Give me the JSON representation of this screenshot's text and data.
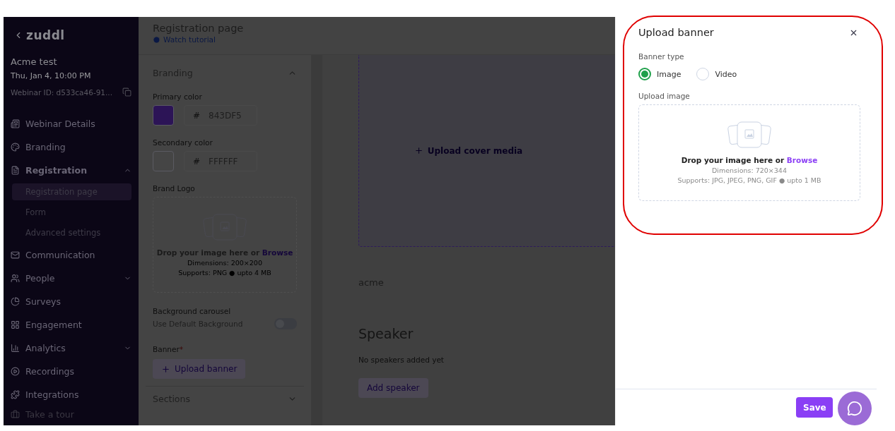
{
  "sidebar": {
    "logo": "zuddl",
    "event": {
      "name": "Acme test",
      "date": "Thu, Jan 4, 10:00 PM",
      "webinar_id": "Webinar ID: d533ca46-91..."
    },
    "nav": [
      {
        "label": "Webinar Details",
        "kind": "link"
      },
      {
        "label": "Branding",
        "kind": "link"
      },
      {
        "label": "Registration",
        "kind": "group",
        "expanded": true,
        "children": [
          {
            "label": "Registration page",
            "selected": true
          },
          {
            "label": "Form",
            "selected": false
          },
          {
            "label": "Advanced settings",
            "selected": false
          }
        ]
      },
      {
        "label": "Communication",
        "kind": "link"
      },
      {
        "label": "People",
        "kind": "group",
        "expanded": false
      },
      {
        "label": "Surveys",
        "kind": "link"
      },
      {
        "label": "Engagement",
        "kind": "link"
      },
      {
        "label": "Analytics",
        "kind": "group",
        "expanded": false
      },
      {
        "label": "Recordings",
        "kind": "link"
      },
      {
        "label": "Integrations",
        "kind": "link"
      }
    ],
    "tour_button": "Take a tour"
  },
  "header": {
    "title": "Registration page",
    "tutorial_link": "Watch tutorial"
  },
  "settings": {
    "sections": [
      {
        "title": "Branding",
        "expanded": true
      },
      {
        "title": "Sections",
        "expanded": false
      }
    ],
    "primary_color": {
      "label": "Primary color",
      "hash": "#",
      "value": "843DF5",
      "color": "#2c1456"
    },
    "secondary_color": {
      "label": "Secondary color",
      "hash": "#",
      "value": "FFFFFF",
      "color": "#454545"
    },
    "brand_logo": {
      "label": "Brand Logo",
      "prompt": "Drop your image here or",
      "link": "Browse",
      "dimensions": "Dimensions: 200×200",
      "supports": "Supports: PNG ● upto 4 MB"
    },
    "carousel": {
      "label": "Background carousel",
      "toggle_label": "Use Default Background",
      "on": false
    },
    "banner": {
      "label": "Banner",
      "required_mark": "*",
      "button": "Upload banner"
    }
  },
  "preview": {
    "cover_button": "Upload cover media",
    "name": "acme",
    "speaker_title": "Speaker",
    "speaker_empty": "No speakers added yet",
    "add_speaker": "Add speaker"
  },
  "drawer": {
    "title": "Upload banner",
    "banner_type_label": "Banner type",
    "types": [
      {
        "label": "Image",
        "selected": true
      },
      {
        "label": "Video",
        "selected": false
      }
    ],
    "upload_label": "Upload image",
    "prompt": "Drop your image here or",
    "link": "Browse",
    "dimensions": "Dimensions: 720×344",
    "supports": "Supports: JPG, JPEG, PNG, GIF ● upto 1 MB",
    "save": "Save"
  }
}
